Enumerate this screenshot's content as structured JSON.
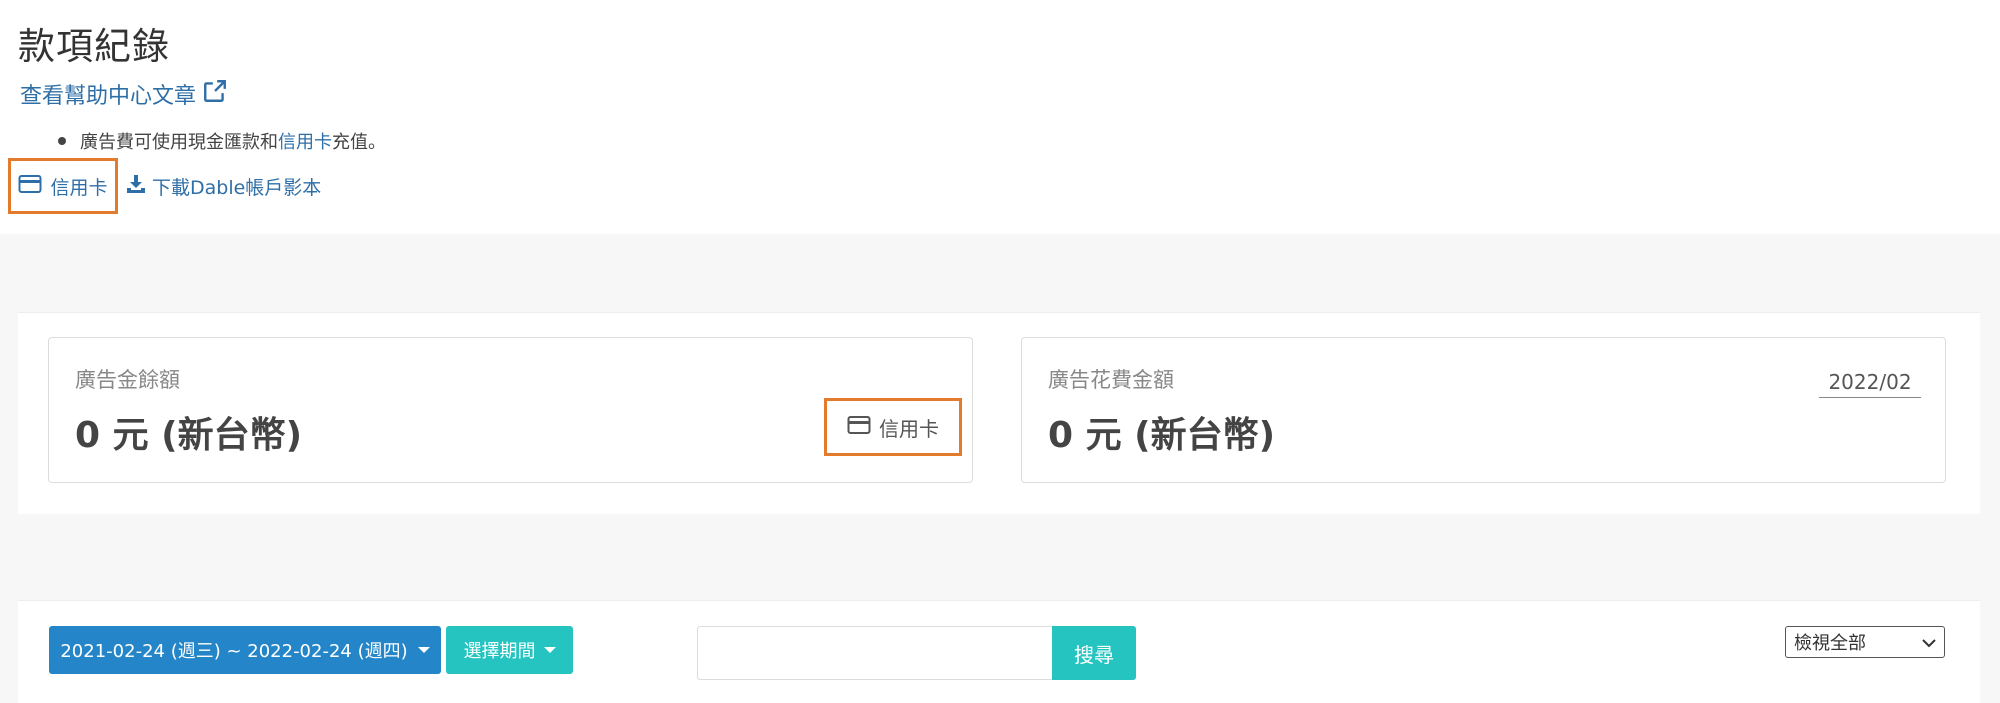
{
  "header": {
    "title": "款項紀錄",
    "help_link": "查看幫助中心文章",
    "note_prefix": "廣告費可使用現金匯款和",
    "note_link": "信用卡",
    "note_suffix": "充值。",
    "card_action": "信用卡",
    "download_action": "下載Dable帳戶影本"
  },
  "balance": {
    "label": "廣告金餘額",
    "amount": "0 元 (新台幣)",
    "card_button": "信用卡"
  },
  "spending": {
    "label": "廣告花費金額",
    "amount": "0 元 (新台幣)",
    "month": "2022/02"
  },
  "filters": {
    "date_range": "2021-02-24 (週三) ~ 2022-02-24 (週四)",
    "period_button": "選擇期間",
    "search_value": "",
    "search_button": "搜尋",
    "view_select": "檢視全部"
  },
  "colors": {
    "link": "#2f6fa7",
    "highlight": "#e37b2c",
    "primary": "#2486c8",
    "teal": "#26c4c0"
  },
  "icons": [
    "external-link-icon",
    "credit-card-icon",
    "download-icon",
    "caret-down-icon",
    "chevron-down-icon"
  ]
}
